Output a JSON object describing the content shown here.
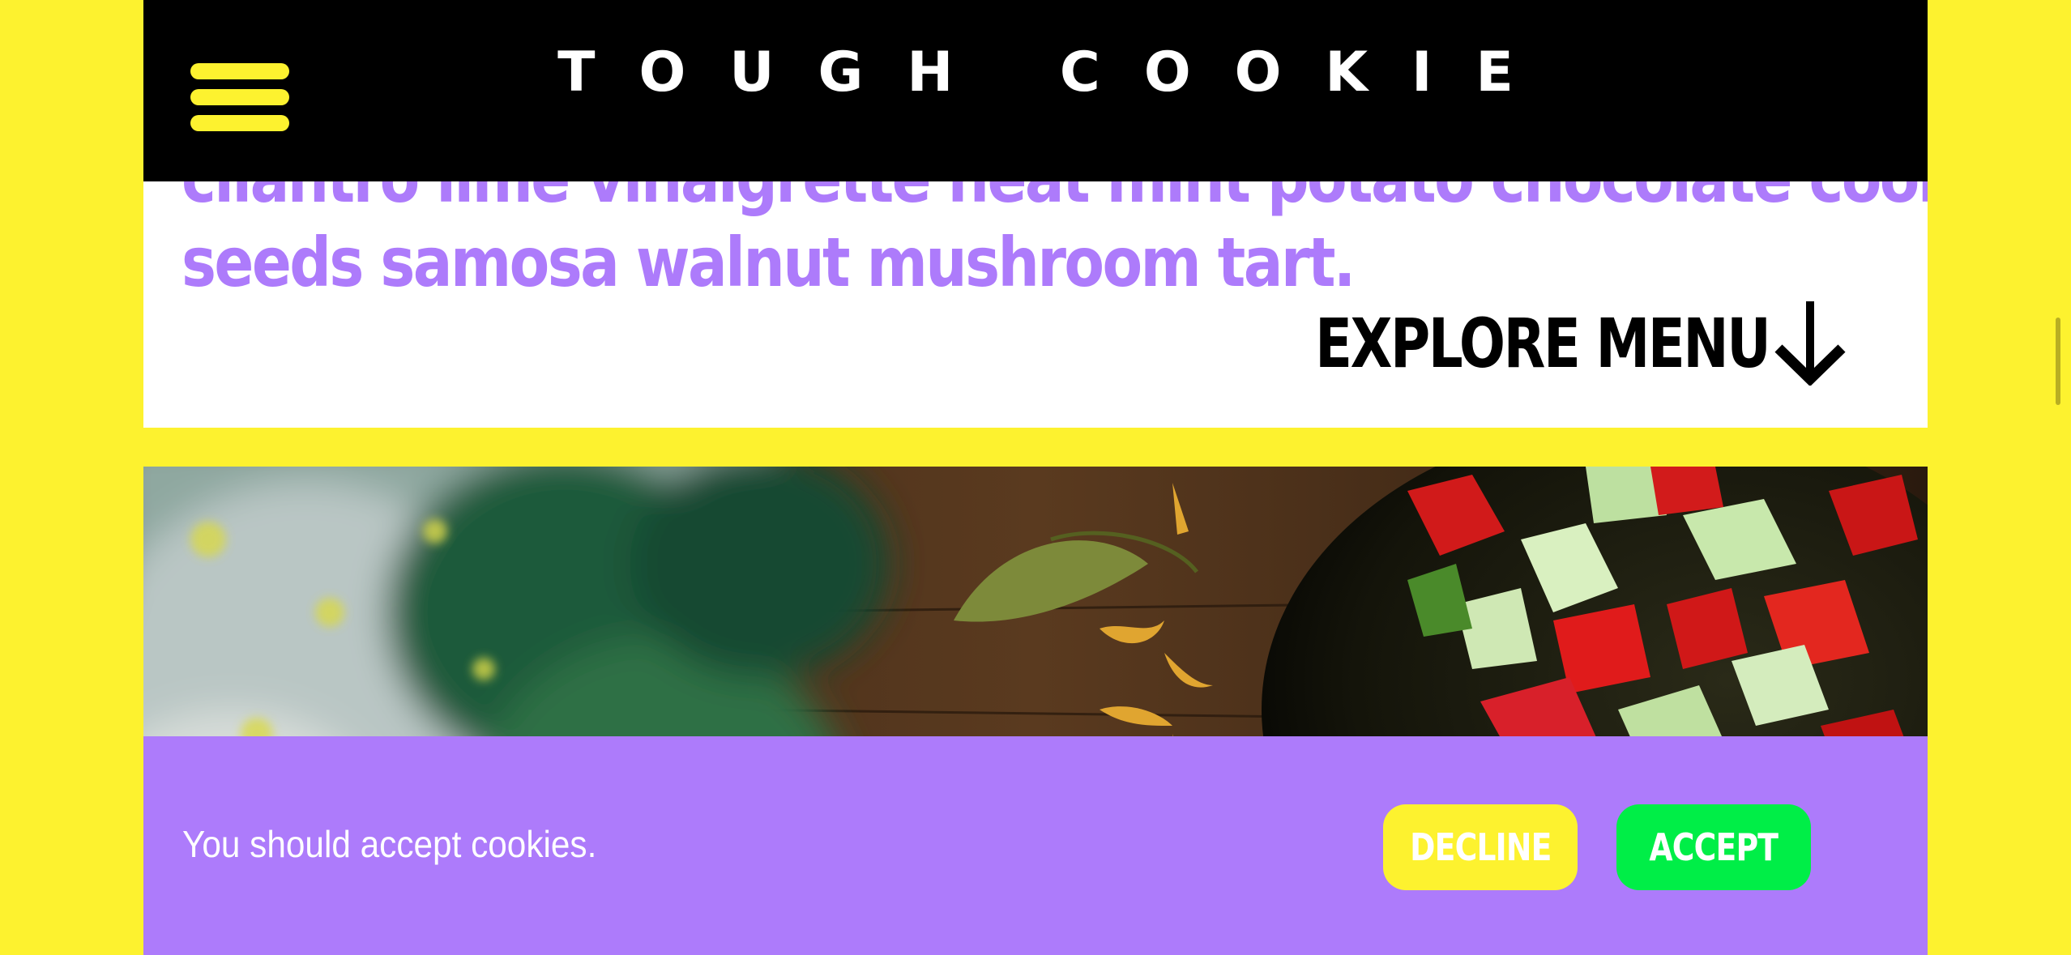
{
  "header": {
    "brand": "TOUGH COOKIE",
    "menu_icon": "hamburger-menu-icon"
  },
  "intro": {
    "lines": [
      "cilantro lime vinaigrette heat mint potato chocolate cookie",
      "seeds samosa walnut mushroom tart."
    ],
    "explore_label": "EXPLORE MENU",
    "explore_icon": "arrow-down-icon"
  },
  "photo": {
    "subject": "salad-bowl-photo"
  },
  "cookie_banner": {
    "message": "You should accept cookies.",
    "decline_label": "DECLINE",
    "accept_label": "ACCEPT"
  },
  "colors": {
    "page_background": "#fdf22f",
    "accent_purple": "#ad7bfb",
    "header_black": "#000000",
    "accept_green": "#00ee47",
    "decline_yellow": "#fdf22f"
  }
}
